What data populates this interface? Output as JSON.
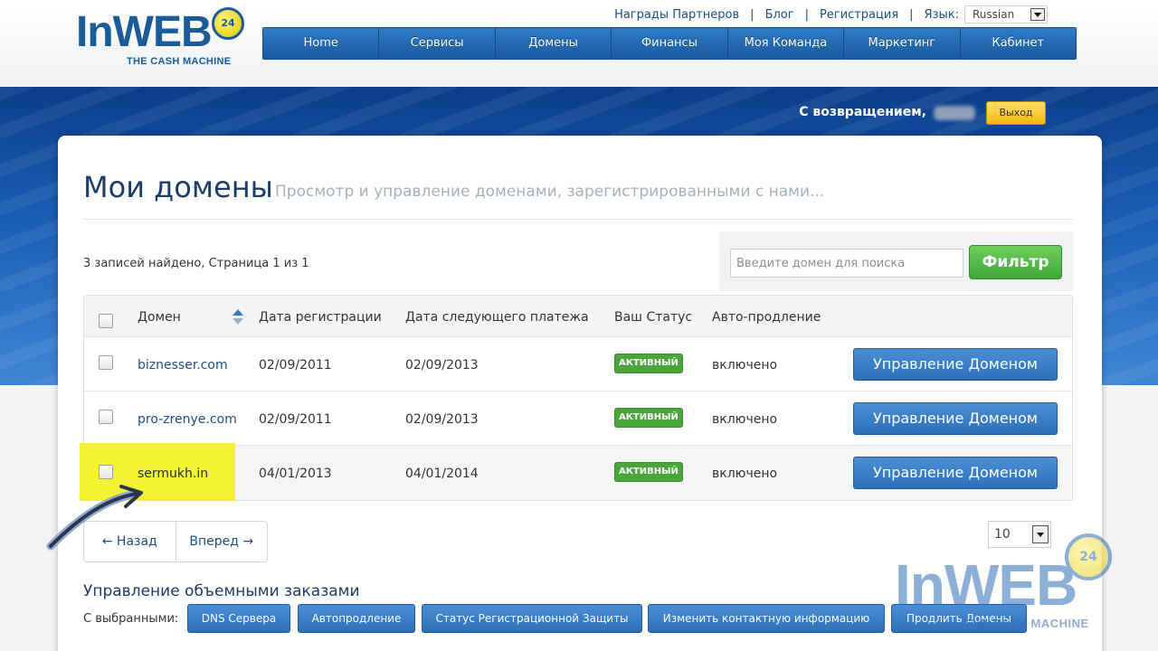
{
  "logo": {
    "text": "InWEB",
    "badge": "24",
    "tagline": "THE CASH MACHINE"
  },
  "toplinks": {
    "items": [
      "Награды Партнеров",
      "Блог",
      "Регистрация"
    ],
    "lang_label": "Язык:",
    "lang_value": "Russian"
  },
  "nav": [
    "Home",
    "Сервисы",
    "Домены",
    "Финансы",
    "Моя Команда",
    "Маркетинг",
    "Кабинет"
  ],
  "welcome": {
    "text": "С возвращением,",
    "logout": "Выход"
  },
  "page": {
    "title": "Мои домены",
    "subtitle": "Просмотр и управление доменами, зарегистрированными с нами...",
    "records": "3 записей найдено, Страница 1 из 1"
  },
  "search": {
    "placeholder": "Введите домен для поиска",
    "button": "Фильтр"
  },
  "table": {
    "headers": [
      "Домен",
      "Дата регистрации",
      "Дата следующего платежа",
      "Ваш Статус",
      "Авто-продление"
    ],
    "rows": [
      {
        "domain": "biznesser.com",
        "reg": "02/09/2011",
        "next": "02/09/2013",
        "status": "АКТИВНЫЙ",
        "auto": "включено",
        "action": "Управление Доменом"
      },
      {
        "domain": "pro-zrenye.com",
        "reg": "02/09/2011",
        "next": "02/09/2013",
        "status": "АКТИВНЫЙ",
        "auto": "включено",
        "action": "Управление Доменом"
      },
      {
        "domain": "sermukh.in",
        "reg": "04/01/2013",
        "next": "04/01/2014",
        "status": "АКТИВНЫЙ",
        "auto": "включено",
        "action": "Управление Доменом"
      }
    ]
  },
  "pager": {
    "prev": "← Назад",
    "next": "Вперед →",
    "per_page": "10"
  },
  "bulk": {
    "title": "Управление объемными заказами",
    "label": "С выбранными:",
    "buttons": [
      "DNS Сервера",
      "Автопродление",
      "Статус Регистрационной Защиты",
      "Изменить контактную информацию",
      "Продлить Домены"
    ]
  },
  "watermark": {
    "text": "InWEB",
    "badge": "24",
    "tagline": "THE CASH MACHINE"
  },
  "colors": {
    "brand_blue": "#1c5b99",
    "nav_blue": "#2e7cc7",
    "active_green": "#4aa63a",
    "highlight_yellow": "#f2f21e",
    "logout_yellow": "#f6b80c"
  }
}
